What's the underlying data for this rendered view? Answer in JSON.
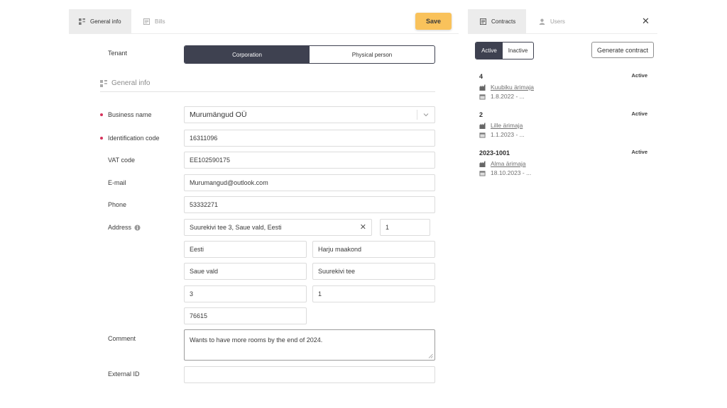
{
  "left_tabs": [
    {
      "label": "General info",
      "icon": "grid-icon",
      "active": true
    },
    {
      "label": "Bills",
      "icon": "bill-icon",
      "active": false
    }
  ],
  "save_label": "Save",
  "form": {
    "tenant": {
      "label": "Tenant",
      "options": [
        "Corporation",
        "Physical person"
      ],
      "selected": "Corporation"
    },
    "section_title": "General info",
    "business_name": {
      "label": "Business name",
      "value": "Murumängud OÜ"
    },
    "identification_code": {
      "label": "Identification code",
      "value": "16311096"
    },
    "vat_code": {
      "label": "VAT code",
      "value": "EE102590175"
    },
    "email": {
      "label": "E-mail",
      "value": "Murumangud@outlook.com"
    },
    "phone": {
      "label": "Phone",
      "value": "53332271"
    },
    "address": {
      "label": "Address",
      "full": "Suurekivi tee 3, Saue vald, Eesti",
      "apartment": "1",
      "country": "Eesti",
      "county": "Harju maakond",
      "municipality": "Saue vald",
      "street": "Suurekivi tee",
      "house": "3",
      "unit": "1",
      "postal_code": "76615"
    },
    "comment": {
      "label": "Comment",
      "value": "Wants to have more rooms by the end of 2024."
    },
    "external_id": {
      "label": "External ID",
      "value": ""
    }
  },
  "right_tabs": [
    {
      "label": "Contracts",
      "icon": "contract-icon",
      "active": true
    },
    {
      "label": "Users",
      "icon": "user-icon",
      "active": false
    }
  ],
  "filter": {
    "options": [
      "Active",
      "Inactive"
    ],
    "selected": "Active"
  },
  "generate_contract_label": "Generate contract",
  "contracts": [
    {
      "number": "4",
      "status": "Active",
      "property": "Kuubiku ärimaja",
      "dates": "1.8.2022 - ..."
    },
    {
      "number": "2",
      "status": "Active",
      "property": "Lille ärimaja",
      "dates": "1.1.2023 - ..."
    },
    {
      "number": "2023-1001",
      "status": "Active",
      "property": "Alma ärimaja",
      "dates": "18.10.2023 - ..."
    }
  ],
  "colors": {
    "accent": "#f9c25b",
    "dark": "#3e4150",
    "required": "#d6335c"
  }
}
